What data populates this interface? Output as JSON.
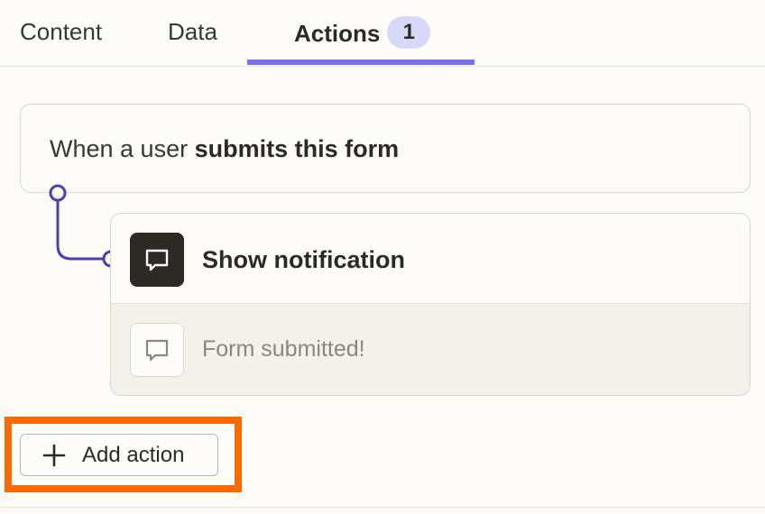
{
  "tabs": [
    {
      "label": "Content"
    },
    {
      "label": "Data"
    },
    {
      "label": "Actions",
      "badge": "1",
      "active": true
    }
  ],
  "trigger": {
    "prefix": "When a user",
    "event": "submits this form"
  },
  "action": {
    "icon": "chat-bubble-icon",
    "title": "Show notification",
    "message_icon": "chat-bubble-outline-icon",
    "message": "Form submitted!"
  },
  "add_action": {
    "icon": "plus-icon",
    "label": "Add action"
  },
  "colors": {
    "accent": "#7b72e6",
    "connector": "#4a3fb0",
    "highlight": "#ff6a00",
    "badge_bg": "#d8d8f8"
  }
}
